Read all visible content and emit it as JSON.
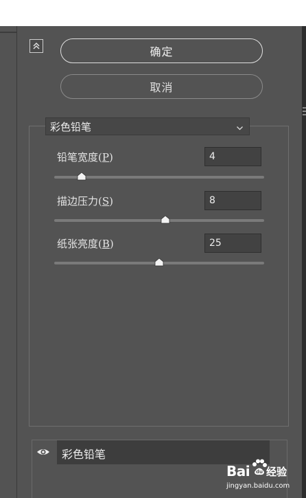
{
  "header": {
    "collapse_icon": "double-chevron-up-icon"
  },
  "actions": {
    "ok_label": "确定",
    "cancel_label": "取消"
  },
  "filter": {
    "selected": "彩色铅笔",
    "params": [
      {
        "label": "铅笔宽度",
        "key": "P",
        "value": "4",
        "slider_fraction": 0.13
      },
      {
        "label": "描边压力",
        "key": "S",
        "value": "8",
        "slider_fraction": 0.53
      },
      {
        "label": "纸张亮度",
        "key": "B",
        "value": "25",
        "slider_fraction": 0.5
      }
    ]
  },
  "layers": {
    "items": [
      {
        "name": "彩色铅笔",
        "visible": true
      }
    ]
  },
  "watermark": {
    "logo": "Bai",
    "brand": "经验",
    "url": "jingyan.baidu.com"
  },
  "colors": {
    "panel": "#535353",
    "input": "#424242",
    "border": "#6f6f6f"
  }
}
